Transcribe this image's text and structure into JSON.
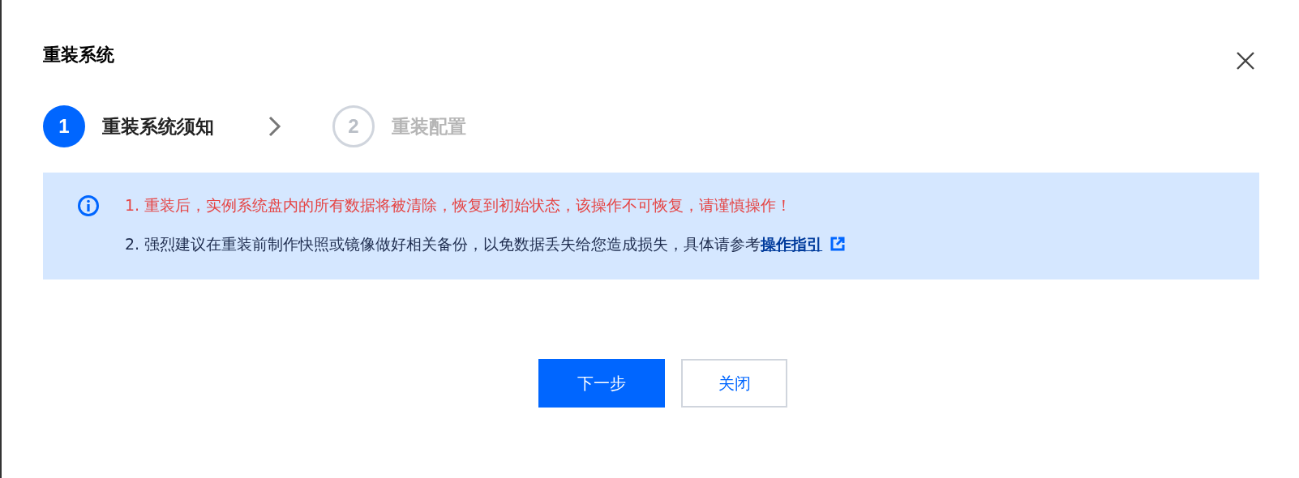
{
  "dialog": {
    "title": "重装系统"
  },
  "steps": [
    {
      "number": "1",
      "label": "重装系统须知",
      "selected": true
    },
    {
      "number": "2",
      "label": "重装配置",
      "selected": false
    }
  ],
  "notices": [
    {
      "kind": "warning",
      "index": "1.",
      "text": "重装后，实例系统盘内的所有数据将被清除，恢复到初始状态，该操作不可恢复，请谨慎操作！"
    },
    {
      "kind": "plain",
      "index": "2.",
      "text": "强烈建议在重装前制作快照或镜像做好相关备份，以免数据丢失给您造成损失，具体请参考",
      "link": "操作指引"
    }
  ],
  "buttons": [
    {
      "kind": "primary",
      "label": "下一步"
    },
    {
      "kind": "secondary",
      "label": "关闭"
    }
  ]
}
